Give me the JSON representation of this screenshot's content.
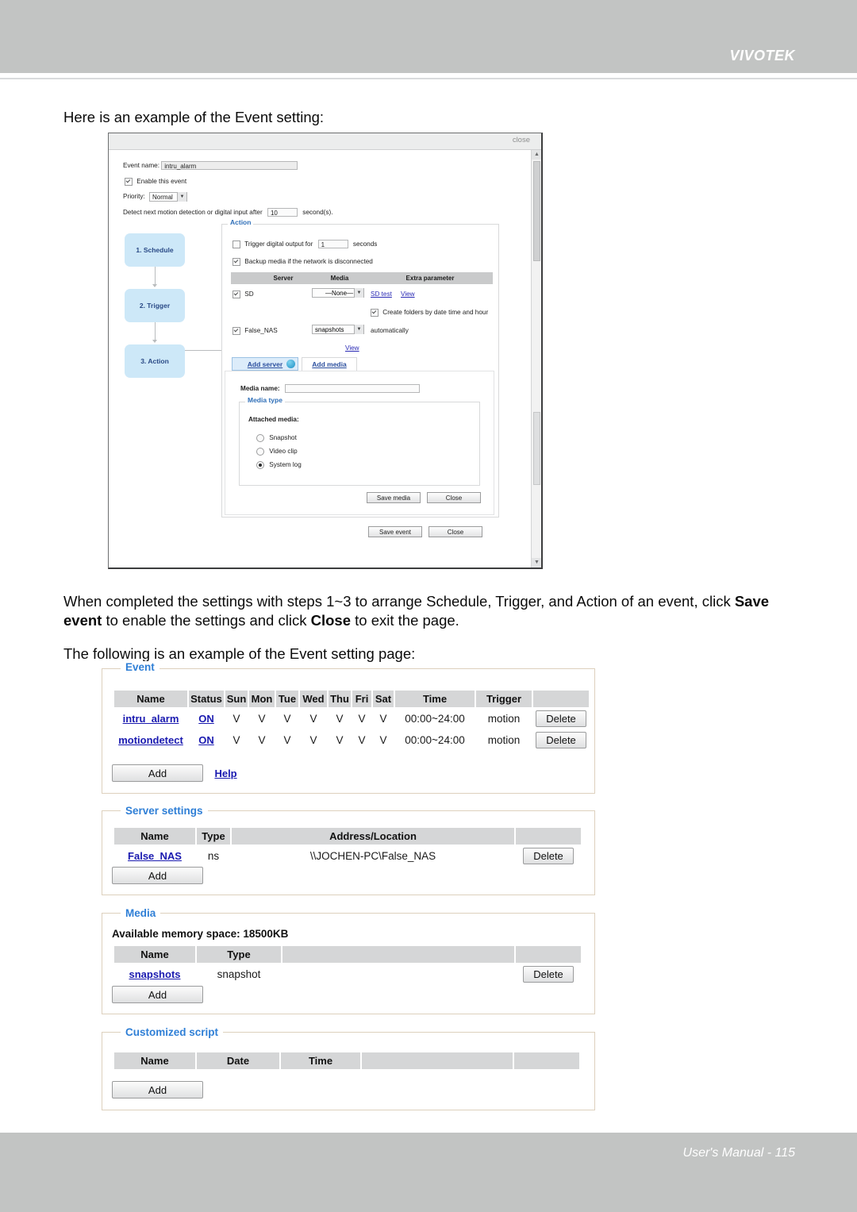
{
  "header": {
    "brand": "VIVOTEK"
  },
  "footer": {
    "text": "User's Manual - 115"
  },
  "body": {
    "intro": "Here is an example of the Event setting:",
    "para2_a": "When completed the settings with steps 1~3 to arrange Schedule, Trigger, and Action of an event, click ",
    "para2_b": "Save event",
    "para2_c": " to enable the settings and click ",
    "para2_d": "Close",
    "para2_e": " to exit the page.",
    "para3": "The following is an example of the Event setting page:"
  },
  "dialog": {
    "close_label": "close",
    "event_name_label": "Event name:",
    "event_name_value": "intru_alarm",
    "enable_event_label": "Enable this event",
    "priority_label": "Priority:",
    "priority_value": "Normal",
    "detect_label_a": "Detect next motion detection or digital input after",
    "detect_value": "10",
    "detect_label_b": "second(s).",
    "flow": [
      {
        "label": "1. Schedule"
      },
      {
        "label": "2. Trigger"
      },
      {
        "label": "3. Action"
      }
    ],
    "action_group_title": "Action",
    "trigger_do_label_a": "Trigger digital output for",
    "trigger_do_value": "1",
    "trigger_do_label_b": "seconds",
    "backup_media_label": "Backup media if the network is disconnected",
    "action_table_headers": [
      "Server",
      "Media",
      "Extra parameter"
    ],
    "sd_row": {
      "name": "SD",
      "media": "—None—",
      "link_sd_test": "SD test",
      "link_view": "View"
    },
    "create_folders_label": "Create folders by date time and hour",
    "nas_row": {
      "name": "False_NAS",
      "media": "snapshots",
      "suffix": "automatically",
      "link_view": "View"
    },
    "tab_add_server": "Add server",
    "tab_add_media": "Add media",
    "media_name_label": "Media name:",
    "media_name_value": "",
    "media_type_group": "Media type",
    "attached_media_label": "Attached media:",
    "media_options": [
      "Snapshot",
      "Video clip",
      "System log"
    ],
    "media_selected": "System log",
    "save_media_btn": "Save media",
    "close_media_btn": "Close",
    "save_event_btn": "Save event",
    "close_event_btn": "Close"
  },
  "event_panel": {
    "legend": "Event",
    "headers": [
      "Name",
      "Status",
      "Sun",
      "Mon",
      "Tue",
      "Wed",
      "Thu",
      "Fri",
      "Sat",
      "Time",
      "Trigger",
      ""
    ],
    "rows": [
      {
        "name": "intru_alarm",
        "status": "ON",
        "days": [
          "V",
          "V",
          "V",
          "V",
          "V",
          "V",
          "V"
        ],
        "time": "00:00~24:00",
        "trigger": "motion",
        "delete": "Delete"
      },
      {
        "name": "motiondetect",
        "status": "ON",
        "days": [
          "V",
          "V",
          "V",
          "V",
          "V",
          "V",
          "V"
        ],
        "time": "00:00~24:00",
        "trigger": "motion",
        "delete": "Delete"
      }
    ],
    "add_btn": "Add",
    "help_link": "Help"
  },
  "server_panel": {
    "legend": "Server settings",
    "headers": [
      "Name",
      "Type",
      "Address/Location",
      ""
    ],
    "rows": [
      {
        "name": "False_NAS",
        "type": "ns",
        "address": "\\\\JOCHEN-PC\\False_NAS",
        "delete": "Delete"
      }
    ],
    "add_btn": "Add"
  },
  "media_panel": {
    "legend": "Media",
    "memory_line": "Available memory space: 18500KB",
    "headers": [
      "Name",
      "Type",
      "",
      ""
    ],
    "rows": [
      {
        "name": "snapshots",
        "type": "snapshot",
        "delete": "Delete"
      }
    ],
    "add_btn": "Add"
  },
  "script_panel": {
    "legend": "Customized script",
    "headers": [
      "Name",
      "Date",
      "Time",
      "",
      ""
    ],
    "rows": [],
    "add_btn": "Add"
  },
  "colors": {
    "header_gray": "#c2c4c3",
    "legend_blue": "#2f7fd6",
    "link_blue": "#1a1ab0",
    "fieldset_border": "#ddd0bd",
    "table_header_gray": "#d5d6d7",
    "flow_box_blue": "#cde8f8"
  }
}
